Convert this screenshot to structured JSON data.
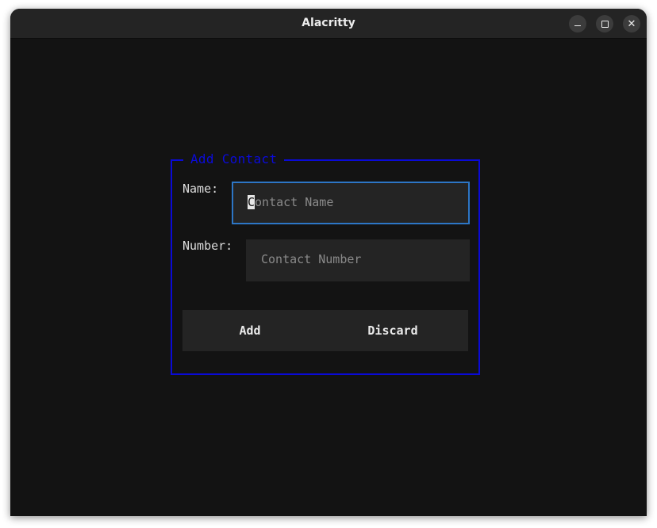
{
  "window": {
    "title": "Alacritty",
    "controls": {
      "minimize_icon": "minimize-icon",
      "maximize_icon": "maximize-icon",
      "close_icon": "close-icon",
      "close_glyph": "✕"
    }
  },
  "dialog": {
    "title": "Add Contact",
    "name_label": "Name:",
    "name_placeholder_first": "C",
    "name_placeholder_rest": "ontact Name",
    "number_label": "Number:",
    "number_placeholder": "Contact Number",
    "add_label": "Add",
    "discard_label": "Discard"
  },
  "colors": {
    "background": "#131313",
    "titlebar": "#242424",
    "dialog_border": "#0a0ad6",
    "focused_field_border": "#2d76c6",
    "field_background": "#242424"
  }
}
